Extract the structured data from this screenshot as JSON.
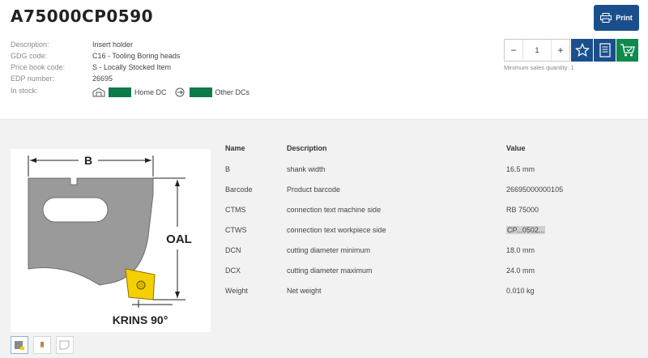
{
  "product": {
    "title": "A75000CP0590"
  },
  "info": {
    "rows": [
      {
        "label": "Description:",
        "value": "Insert holder"
      },
      {
        "label": "GDG code:",
        "value": "C16 - Tooling Boring heads"
      },
      {
        "label": "Price book code:",
        "value": "S - Locally Stocked Item"
      },
      {
        "label": "EDP number:",
        "value": "26695"
      }
    ],
    "in_stock_label": "In stock:",
    "home_dc": "Home DC",
    "other_dcs": "Other DCs",
    "stock_color": "#0e7a4a"
  },
  "actions": {
    "print_label": "Print",
    "quantity": "1",
    "minus": "−",
    "plus": "+",
    "min_sales_qty": "Minimum sales quantity: 1",
    "icons": [
      "favorite-star-icon",
      "list-icon",
      "cart-icon"
    ]
  },
  "drawing": {
    "dim_b": "B",
    "dim_oal": "OAL",
    "dim_krins": "KRINS 90°"
  },
  "table": {
    "headers": {
      "name": "Name",
      "description": "Description",
      "value": "Value"
    },
    "rows": [
      {
        "name": "B",
        "description": "shank width",
        "value": "16.5 mm"
      },
      {
        "name": "Barcode",
        "description": "Product barcode",
        "value": "26695000000105"
      },
      {
        "name": "CTMS",
        "description": "connection text machine side",
        "value": "RB 75000"
      },
      {
        "name": "CTWS",
        "description": "connection text workpiece side",
        "value": "CP...0502..."
      },
      {
        "name": "DCN",
        "description": "cutting diameter minimum",
        "value": "18.0 mm"
      },
      {
        "name": "DCX",
        "description": "cutting diameter maximum",
        "value": "24.0 mm"
      },
      {
        "name": "Weight",
        "description": "Net weight",
        "value": "0.010 kg"
      }
    ]
  },
  "colors": {
    "brand_blue": "#1a4f8c",
    "cart_green": "#0e8a4e",
    "insert_yellow": "#f5d000"
  }
}
